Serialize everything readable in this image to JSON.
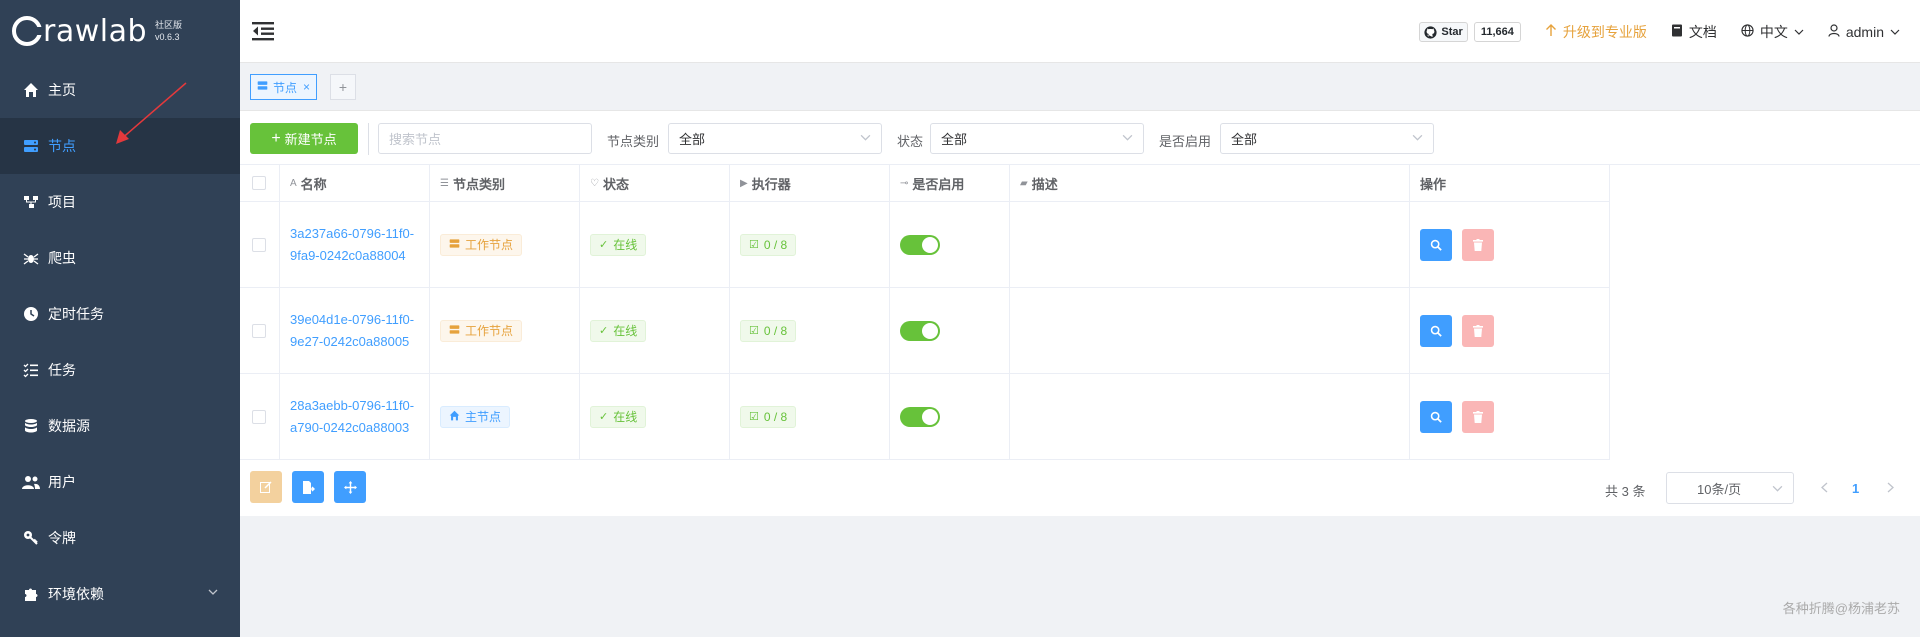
{
  "app": {
    "logo_text": "rawlab",
    "edition": "社区版",
    "version": "v0.6.3"
  },
  "sidebar": {
    "items": [
      {
        "label": "主页",
        "icon": "home-icon"
      },
      {
        "label": "节点",
        "icon": "server-icon",
        "active": true
      },
      {
        "label": "项目",
        "icon": "project-icon"
      },
      {
        "label": "爬虫",
        "icon": "spider-icon"
      },
      {
        "label": "定时任务",
        "icon": "clock-icon"
      },
      {
        "label": "任务",
        "icon": "task-list-icon"
      },
      {
        "label": "数据源",
        "icon": "database-icon"
      },
      {
        "label": "用户",
        "icon": "users-icon"
      },
      {
        "label": "令牌",
        "icon": "key-icon"
      },
      {
        "label": "环境依赖",
        "icon": "puzzle-icon"
      }
    ]
  },
  "header": {
    "github_star_label": "Star",
    "github_star_count": "11,664",
    "upgrade_label": "升级到专业版",
    "docs_label": "文档",
    "language_label": "中文",
    "user_label": "admin"
  },
  "tabs": {
    "items": [
      {
        "label": "节点"
      }
    ],
    "add_label": "+"
  },
  "toolbar": {
    "new_button_label": "新建节点",
    "search_placeholder": "搜索节点",
    "filters": [
      {
        "label": "节点类别",
        "value": "全部"
      },
      {
        "label": "状态",
        "value": "全部"
      },
      {
        "label": "是否启用",
        "value": "全部"
      }
    ]
  },
  "table": {
    "columns": [
      "名称",
      "节点类别",
      "状态",
      "执行器",
      "是否启用",
      "描述",
      "操作"
    ],
    "rows": [
      {
        "name": "3a237a66-0796-11f0-9fa9-0242c0a88004",
        "type": "工作节点",
        "type_kind": "worker",
        "status": "在线",
        "executors": "0 / 8",
        "enabled": true,
        "description": ""
      },
      {
        "name": "39e04d1e-0796-11f0-9e27-0242c0a88005",
        "type": "工作节点",
        "type_kind": "worker",
        "status": "在线",
        "executors": "0 / 8",
        "enabled": true,
        "description": ""
      },
      {
        "name": "28a3aebb-0796-11f0-a790-0242c0a88003",
        "type": "主节点",
        "type_kind": "master",
        "status": "在线",
        "executors": "0 / 8",
        "enabled": true,
        "description": ""
      }
    ]
  },
  "pagination": {
    "total_label": "共 3 条",
    "page_size_label": "10条/页",
    "current_page": "1"
  },
  "watermark": "各种折腾@杨浦老苏",
  "colors": {
    "sidebar_bg": "#304156",
    "primary": "#409eff",
    "success": "#67c23a",
    "warning": "#e6a23c",
    "danger_light": "#fab6b6"
  }
}
